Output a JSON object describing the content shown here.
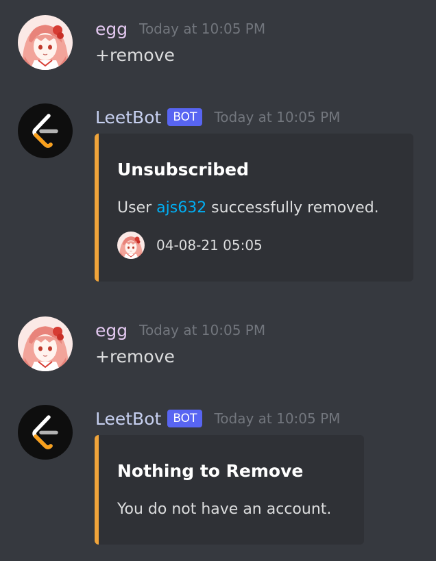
{
  "messages": [
    {
      "author": "egg",
      "timestamp": "Today at 10:05 PM",
      "content": "+remove",
      "avatar_icon": "anime-girl-avatar"
    },
    {
      "author": "LeetBot",
      "bot_tag": "BOT",
      "timestamp": "Today at 10:05 PM",
      "avatar_icon": "leetcode-logo-avatar",
      "embed": {
        "accent_color": "#f0a43a",
        "title": "Unsubscribed",
        "desc_prefix": "User ",
        "desc_mention": "ajs632",
        "desc_suffix": " successfully removed.",
        "footer_text": "04-08-21 05:05",
        "footer_icon": "anime-girl-avatar"
      }
    },
    {
      "author": "egg",
      "timestamp": "Today at 10:05 PM",
      "content": "+remove",
      "avatar_icon": "anime-girl-avatar"
    },
    {
      "author": "LeetBot",
      "bot_tag": "BOT",
      "timestamp": "Today at 10:05 PM",
      "avatar_icon": "leetcode-logo-avatar",
      "embed": {
        "accent_color": "#f0a43a",
        "title": "Nothing to Remove",
        "description": "You do not have an account."
      }
    }
  ],
  "colors": {
    "background": "#36393f",
    "embed_background": "#2f3136",
    "bot_tag": "#5865f2",
    "mention": "#00aff4"
  }
}
